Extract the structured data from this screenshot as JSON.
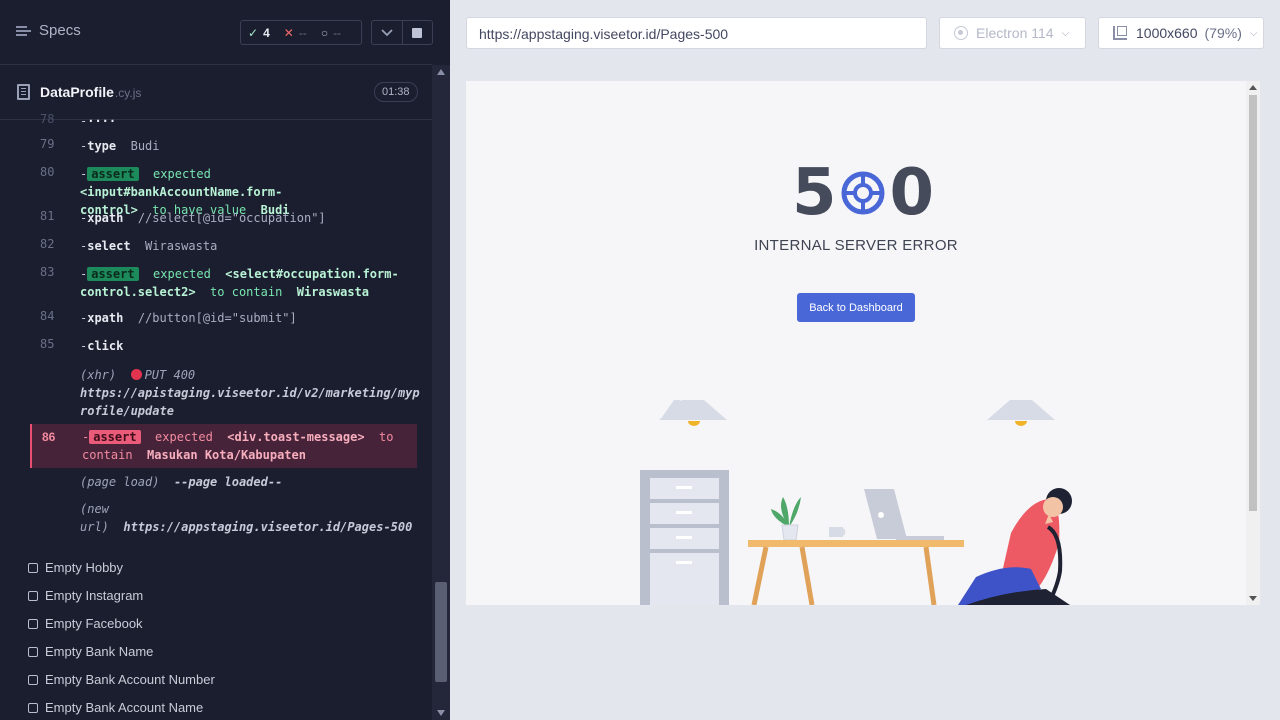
{
  "runner": {
    "specs_label": "Specs",
    "stats": {
      "passed": "4",
      "failed": "--",
      "pending": "--"
    },
    "spec_file": {
      "name": "DataProfile",
      "ext": ".cy.js"
    },
    "duration": "01:38",
    "commands": [
      {
        "num": "79",
        "name": "type",
        "arg": "Budi"
      },
      {
        "num": "80",
        "assert_line1": "expected",
        "subject": "<input#bankAccountName.form-",
        "subject2": "control>",
        "verb": "to have value",
        "value": "Budi"
      },
      {
        "num": "81",
        "name": "xpath",
        "arg": "//select[@id=\"occupation\"]"
      },
      {
        "num": "82",
        "name": "select",
        "arg": "Wiraswasta"
      },
      {
        "num": "83",
        "assert_line1": "expected",
        "subject": "<select#occupation.form-",
        "subject2": "control.select2>",
        "verb": "to contain",
        "value": "Wiraswasta"
      },
      {
        "num": "84",
        "name": "xpath",
        "arg": "//button[@id=\"submit\"]"
      },
      {
        "num": "85",
        "name": "click"
      }
    ],
    "badge_label": "assert",
    "xhr": {
      "label": "(xhr)",
      "method_status": "PUT 400",
      "url_line1": "https://apistaging.viseetor.id/v2/marketing/myp",
      "url_line2": "rofile/update"
    },
    "failed_assert": {
      "num": "86",
      "expected": "expected",
      "subject": "<div.toast-message>",
      "verb": "to",
      "verb2": "contain",
      "value": "Masukan Kota/Kabupaten"
    },
    "page_load": {
      "label": "(page load)",
      "text": "--page loaded--"
    },
    "new_url": {
      "label1": "(new",
      "label2": "url)",
      "url": "https://appstaging.viseetor.id/Pages-500"
    },
    "tests": [
      "Empty Hobby",
      "Empty Instagram",
      "Empty Facebook",
      "Empty Bank Name",
      "Empty Bank Account Number",
      "Empty Bank Account Name"
    ]
  },
  "preview": {
    "url": "https://appstaging.viseetor.id/Pages-500",
    "browser": "Electron 114",
    "viewport": "1000x660",
    "zoom": "(79%)",
    "page": {
      "digit_left": "5",
      "digit_right": "0",
      "title": "INTERNAL SERVER ERROR",
      "button": "Back to Dashboard"
    }
  },
  "colors": {
    "accent": "#4a67d8",
    "pass": "#1c8a5b",
    "fail": "#ea5b7a"
  }
}
